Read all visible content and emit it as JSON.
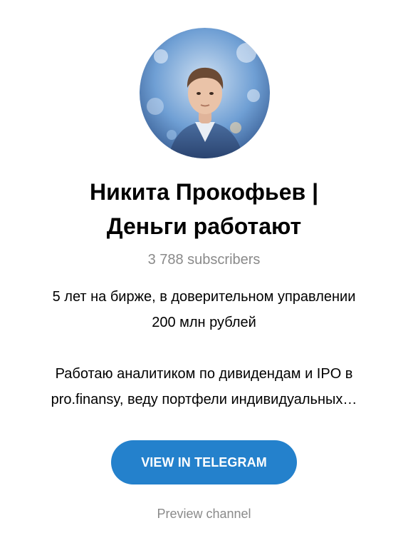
{
  "channel": {
    "title_line1": "Никита Прокофьев |",
    "title_line2": "Деньги работают",
    "subscribers": "3 788 subscribers",
    "description_line1": "5 лет на бирже, в доверительном управлении",
    "description_line2": "200 млн рублей",
    "description_line3": "Работаю аналитиком по дивидендам и IPO в",
    "description_line4": "pro.finansy, веду портфели индивидуальных…"
  },
  "actions": {
    "view_in_telegram_label": "VIEW IN TELEGRAM",
    "preview_channel_label": "Preview channel"
  },
  "colors": {
    "button_bg": "#2481cc",
    "secondary_text": "#8a8a8a"
  }
}
